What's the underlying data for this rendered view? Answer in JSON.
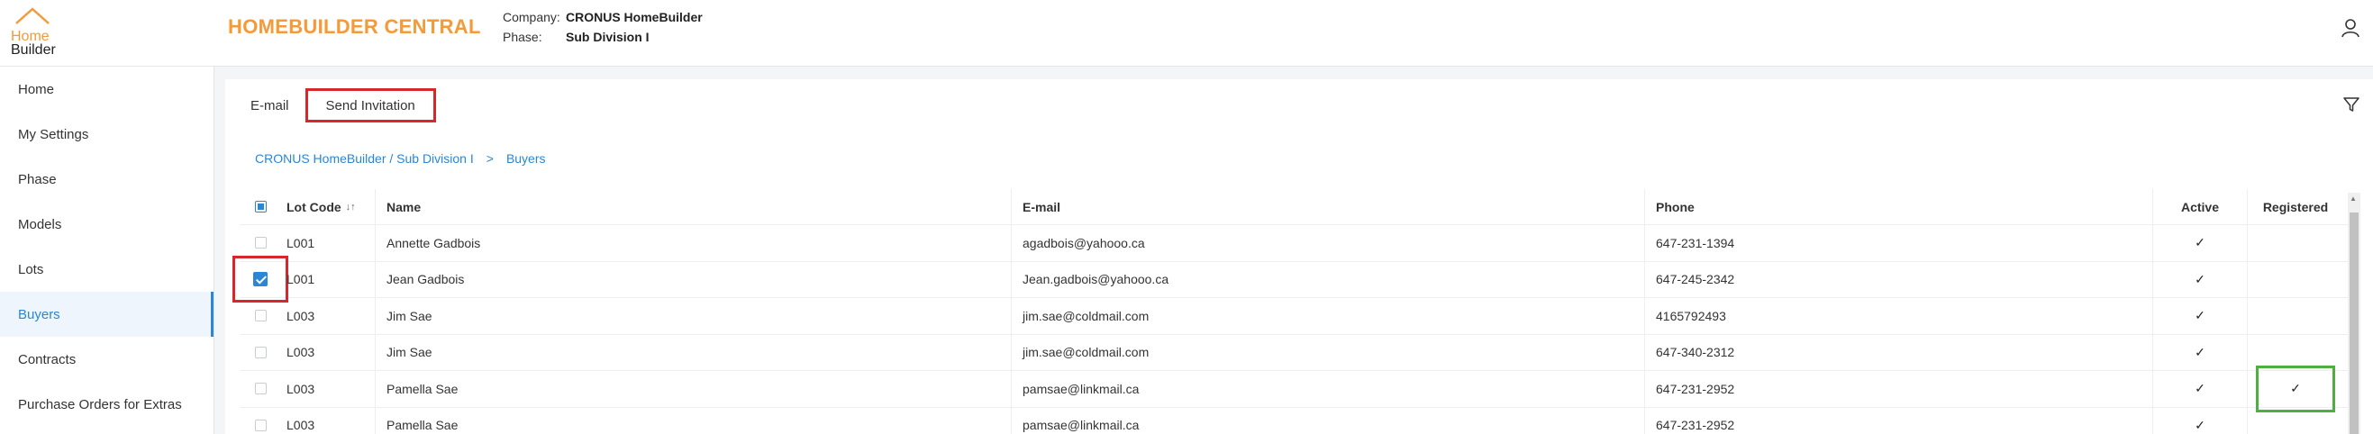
{
  "header": {
    "logo_line1": "Home",
    "logo_line2": "Builder",
    "app_title": "HOMEBUILDER CENTRAL",
    "company_label": "Company:",
    "company_value": "CRONUS HomeBuilder",
    "phase_label": "Phase:",
    "phase_value": "Sub Division I"
  },
  "sidebar": {
    "items": [
      {
        "label": "Home"
      },
      {
        "label": "My Settings"
      },
      {
        "label": "Phase"
      },
      {
        "label": "Models"
      },
      {
        "label": "Lots"
      },
      {
        "label": "Buyers",
        "active": true
      },
      {
        "label": "Contracts"
      },
      {
        "label": "Purchase Orders for Extras"
      }
    ]
  },
  "tabs": {
    "email": "E-mail",
    "send_invitation": "Send Invitation"
  },
  "breadcrumb": {
    "parent": "CRONUS HomeBuilder / Sub Division I",
    "separator": ">",
    "current": "Buyers"
  },
  "table": {
    "headers": {
      "lot_code": "Lot Code",
      "name": "Name",
      "email": "E-mail",
      "phone": "Phone",
      "active": "Active",
      "registered": "Registered"
    },
    "rows": [
      {
        "lot": "L001",
        "name": "Annette Gadbois",
        "email": "agadbois@yahooo.ca",
        "phone": "647-231-1394",
        "active": "✓",
        "registered": ""
      },
      {
        "lot": "L001",
        "name": "Jean Gadbois",
        "email": "Jean.gadbois@yahooo.ca",
        "phone": "647-245-2342",
        "active": "✓",
        "registered": ""
      },
      {
        "lot": "L003",
        "name": "Jim Sae",
        "email": "jim.sae@coldmail.com",
        "phone": "4165792493",
        "active": "✓",
        "registered": ""
      },
      {
        "lot": "L003",
        "name": "Jim Sae",
        "email": "jim.sae@coldmail.com",
        "phone": "647-340-2312",
        "active": "✓",
        "registered": ""
      },
      {
        "lot": "L003",
        "name": "Pamella Sae",
        "email": "pamsae@linkmail.ca",
        "phone": "647-231-2952",
        "active": "✓",
        "registered": "✓"
      },
      {
        "lot": "L003",
        "name": "Pamella Sae",
        "email": "pamsae@linkmail.ca",
        "phone": "647-231-2952",
        "active": "✓",
        "registered": ""
      }
    ]
  },
  "icons": {
    "user": "user-icon",
    "filter": "filter-icon",
    "sort": "sort-icon"
  },
  "colors": {
    "accent": "#2b86d6",
    "brand_orange": "#f39a3a",
    "highlight_red": "#d9262c",
    "highlight_green": "#4caf3f"
  }
}
